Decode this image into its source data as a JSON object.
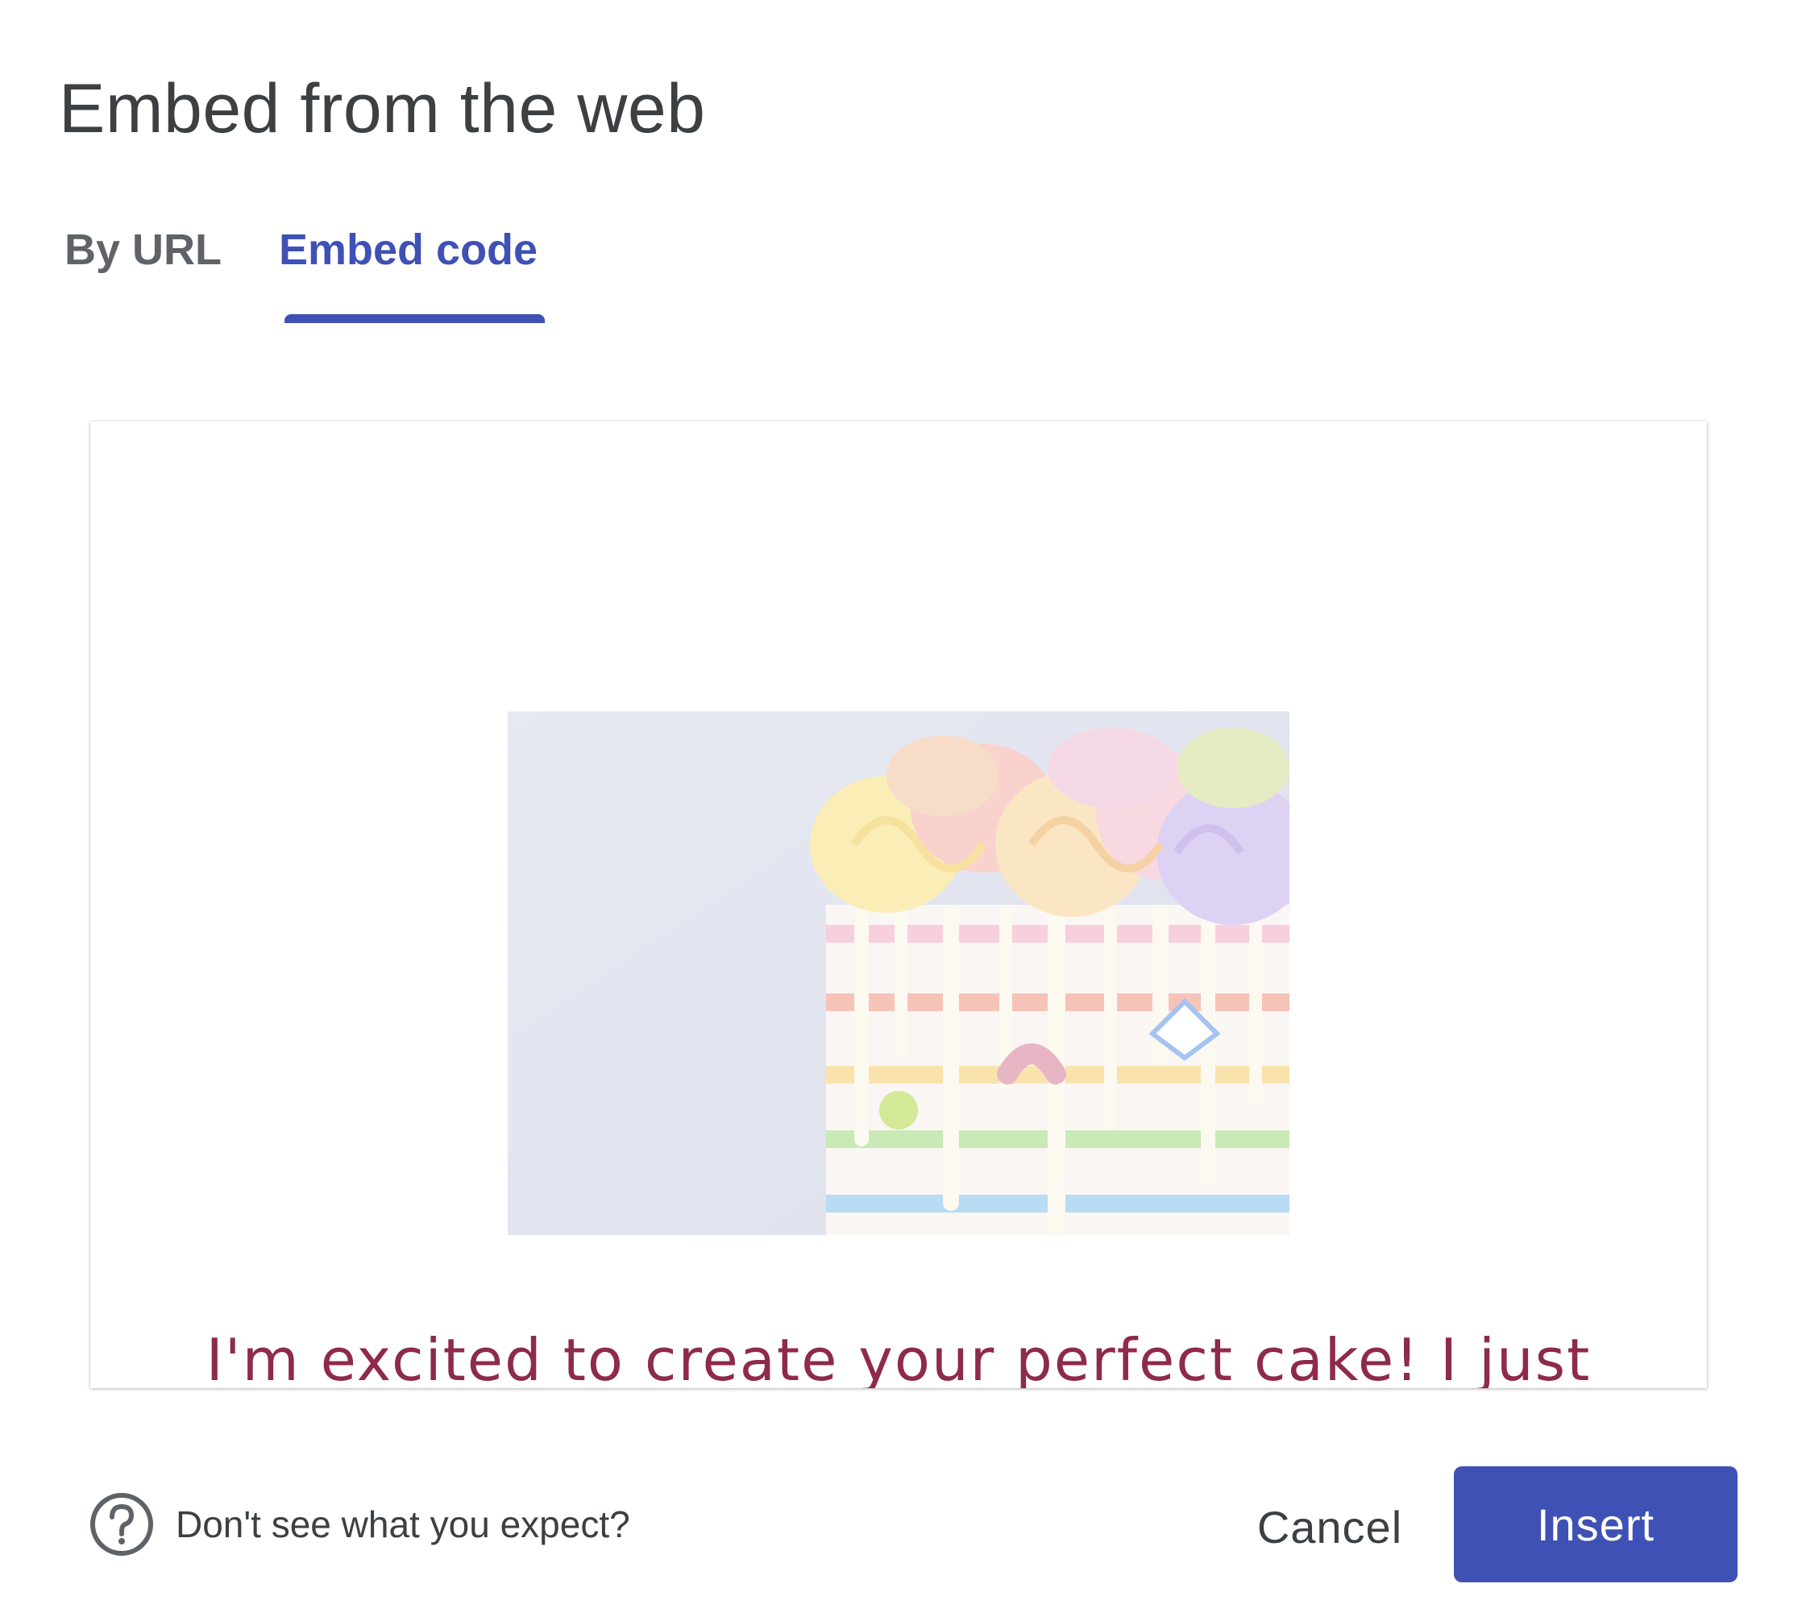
{
  "dialog": {
    "title": "Embed from the web"
  },
  "tabs": [
    {
      "label": "By URL",
      "active": false
    },
    {
      "label": "Embed code",
      "active": true
    }
  ],
  "preview": {
    "image": "cake-photo",
    "text": "I'm excited to create your perfect cake! I just"
  },
  "footer": {
    "help_icon": "help-circle-icon",
    "help_text": "Don't see what you expect?",
    "cancel_label": "Cancel",
    "insert_label": "Insert"
  },
  "colors": {
    "accent": "#3f51b5",
    "title_text": "#3c4043",
    "inactive_tab": "#5f6368",
    "preview_text": "#8e2a4a"
  }
}
